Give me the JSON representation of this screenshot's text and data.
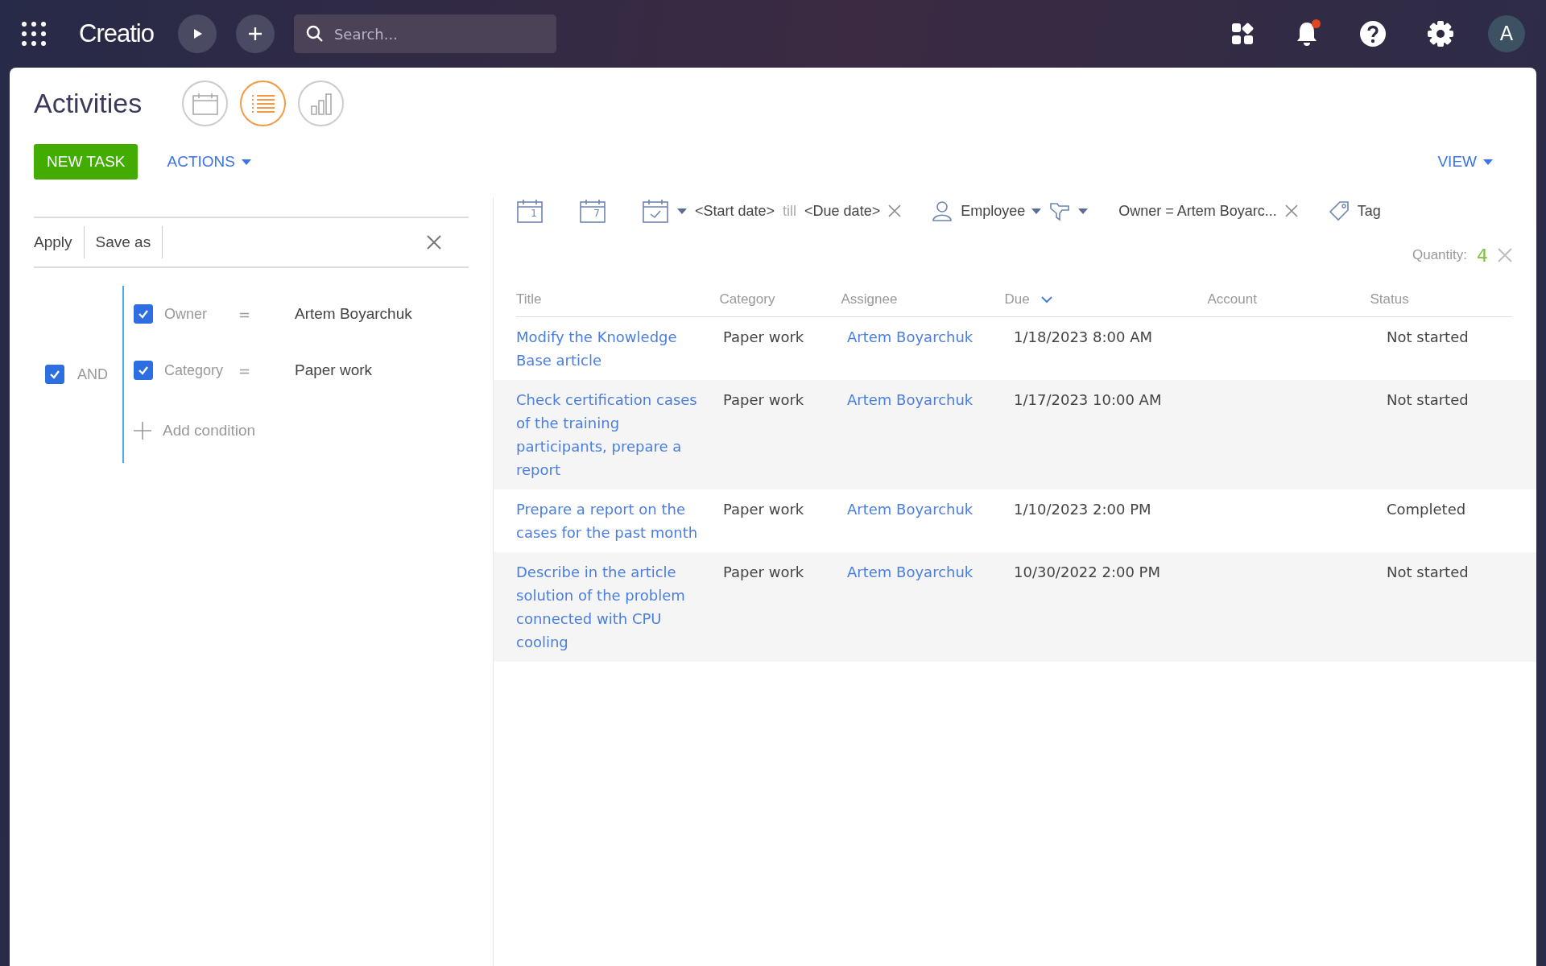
{
  "topbar": {
    "logo": "Creatio",
    "search": {
      "placeholder": "Search..."
    },
    "notifications": {
      "unread": true
    },
    "avatar": "A"
  },
  "page": {
    "title": "Activities",
    "views": [
      {
        "kind": "calendar",
        "selected": false
      },
      {
        "kind": "list",
        "selected": true
      },
      {
        "kind": "chart",
        "selected": false
      }
    ],
    "new_button": "NEW TASK",
    "actions": "ACTIONS",
    "view": "VIEW"
  },
  "filter_panel": {
    "apply": "Apply",
    "save_as": "Save as",
    "group": {
      "checked": true,
      "operator": "AND"
    },
    "conditions": [
      {
        "checked": true,
        "field": "Owner",
        "op": "=",
        "value": "Artem Boyarchuk"
      },
      {
        "checked": true,
        "field": "Category",
        "op": "=",
        "value": "Paper work"
      }
    ],
    "add_condition": "Add condition"
  },
  "quick_filters": {
    "day": "1",
    "week": "7",
    "period_start": "<Start date>",
    "period_till": "till",
    "period_end": "<Due date>",
    "employee": "Employee",
    "owner_filter": "Owner = Artem Boyarc...",
    "tag": "Tag"
  },
  "quantity": {
    "label": "Quantity:",
    "value": "4"
  },
  "table": {
    "columns": [
      {
        "label": "Title",
        "sorted": false
      },
      {
        "label": "Category",
        "sorted": false
      },
      {
        "label": "Assignee",
        "sorted": false
      },
      {
        "label": "Due",
        "sorted": true
      },
      {
        "label": "Account",
        "sorted": false
      },
      {
        "label": "Status",
        "sorted": false
      }
    ],
    "rows": [
      {
        "title": "Modify the Knowledge Base article",
        "category": "Paper work",
        "assignee": "Artem Boyarchuk",
        "due": "1/18/2023 8:00 AM",
        "status": "Not started"
      },
      {
        "title": "Check certification cases of the training participants, prepare a report",
        "category": "Paper work",
        "assignee": "Artem Boyarchuk",
        "due": "1/17/2023 10:00 AM",
        "status": "Not started"
      },
      {
        "title": "Prepare a report on the cases for the past month",
        "category": "Paper work",
        "assignee": "Artem Boyarchuk",
        "due": "1/10/2023 2:00 PM",
        "status": "Completed"
      },
      {
        "title": "Describe in the article solution of the problem connected with CPU cooling",
        "category": "Paper work",
        "assignee": "Artem Boyarchuk",
        "due": "10/30/2022 2:00 PM",
        "status": "Not started"
      }
    ]
  }
}
